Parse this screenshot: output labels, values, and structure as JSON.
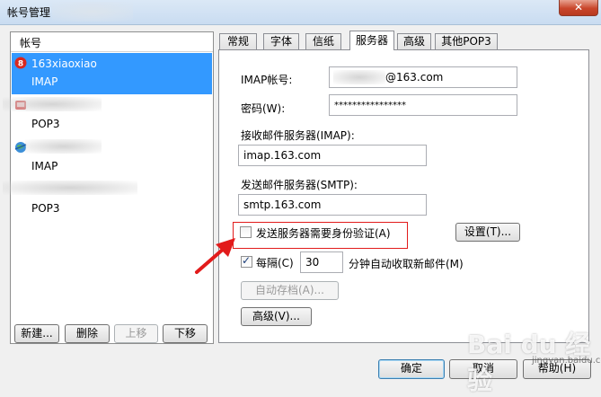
{
  "window": {
    "title": "帐号管理"
  },
  "account_list": {
    "header": "帐号",
    "accounts": [
      {
        "name": "163xiaoxiao",
        "type": "IMAP"
      },
      {
        "name": "",
        "type": "POP3"
      },
      {
        "name": "",
        "type": "IMAP"
      },
      {
        "name": "",
        "type": "POP3"
      }
    ],
    "buttons": {
      "new": "新建...",
      "delete": "删除",
      "move_up": "上移",
      "move_down": "下移"
    }
  },
  "tabs": [
    "常规",
    "字体",
    "信纸",
    "服务器",
    "高级",
    "其他POP3"
  ],
  "active_tab": "服务器",
  "server": {
    "imap_account_label": "IMAP帐号:",
    "imap_account_value": "@163.com",
    "password_label": "密码(W):",
    "password_value": "****************",
    "incoming_label": "接收邮件服务器(IMAP):",
    "incoming_value": "imap.163.com",
    "outgoing_label": "发送邮件服务器(SMTP):",
    "outgoing_value": "smtp.163.com",
    "auth_label": "发送服务器需要身份验证(A)",
    "settings_button": "设置(T)...",
    "every_label": "每隔(C)",
    "every_value": "30",
    "minutes_label": "分钟自动收取新邮件(M)",
    "auto_archive_button": "自动存档(A)...",
    "advanced_button": "高级(V)..."
  },
  "footer": {
    "ok": "确定",
    "cancel": "取消",
    "help": "帮助(H)"
  },
  "watermark": {
    "brand": "Bai du 经验",
    "url": "jingyan.baidu.com"
  },
  "colors": {
    "selection": "#3399ff",
    "highlight_box": "#e21b1b",
    "arrow": "#e21b1b"
  }
}
